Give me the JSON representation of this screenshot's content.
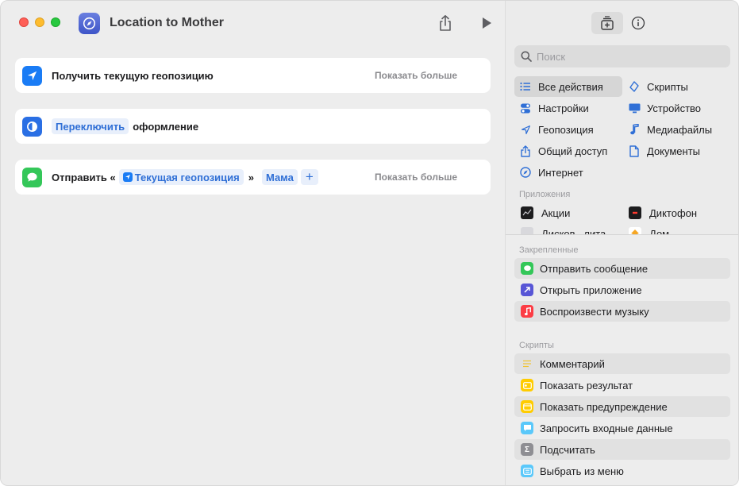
{
  "window": {
    "title": "Location to Mother"
  },
  "actions": [
    {
      "text": "Получить текущую геопозицию",
      "more": "Показать больше"
    },
    {
      "token": "Переключить",
      "text": "оформление"
    },
    {
      "prefix": "Отправить «",
      "token_location": "Текущая геопозиция",
      "mid": "»",
      "token_recipient": "Мама",
      "add": "+",
      "more": "Показать больше"
    }
  ],
  "library": {
    "search_placeholder": "Поиск",
    "categories": [
      {
        "label": "Все действия",
        "icon": "list-icon"
      },
      {
        "label": "Скрипты",
        "icon": "scripting-icon"
      },
      {
        "label": "Настройки",
        "icon": "toggle-icon"
      },
      {
        "label": "Устройство",
        "icon": "display-icon"
      },
      {
        "label": "Геопозиция",
        "icon": "location-icon"
      },
      {
        "label": "Медиафайлы",
        "icon": "music-note-icon"
      },
      {
        "label": "Общий доступ",
        "icon": "share-icon"
      },
      {
        "label": "Документы",
        "icon": "document-icon"
      },
      {
        "label": "Интернет",
        "icon": "compass-icon"
      }
    ],
    "apps_label": "Приложения",
    "apps": [
      {
        "label": "Акции",
        "icon": "stocks-icon"
      },
      {
        "label": "Диктофон",
        "icon": "voice-memos-icon"
      },
      {
        "label": "Дисков...лита",
        "icon": "disk-utility-icon"
      },
      {
        "label": "Дом",
        "icon": "home-icon"
      }
    ],
    "pinned_label": "Закрепленные",
    "pinned": [
      {
        "label": "Отправить сообщение",
        "icon": "messages-icon"
      },
      {
        "label": "Открыть приложение",
        "icon": "open-app-icon"
      },
      {
        "label": "Воспроизвести музыку",
        "icon": "music-icon"
      }
    ],
    "scripts_label": "Скрипты",
    "scripts": [
      {
        "label": "Комментарий",
        "icon": "comment-icon"
      },
      {
        "label": "Показать результат",
        "icon": "show-result-icon"
      },
      {
        "label": "Показать предупреждение",
        "icon": "alert-icon"
      },
      {
        "label": "Запросить входные данные",
        "icon": "ask-input-icon"
      },
      {
        "label": "Подсчитать",
        "icon": "count-icon"
      },
      {
        "label": "Выбрать из меню",
        "icon": "choose-menu-icon"
      }
    ]
  },
  "colors": {
    "accent": "#2f6fd6",
    "location_blue": "#1a7cf5",
    "messages_green": "#34c759",
    "appearance_blue": "#2a6fe4"
  }
}
